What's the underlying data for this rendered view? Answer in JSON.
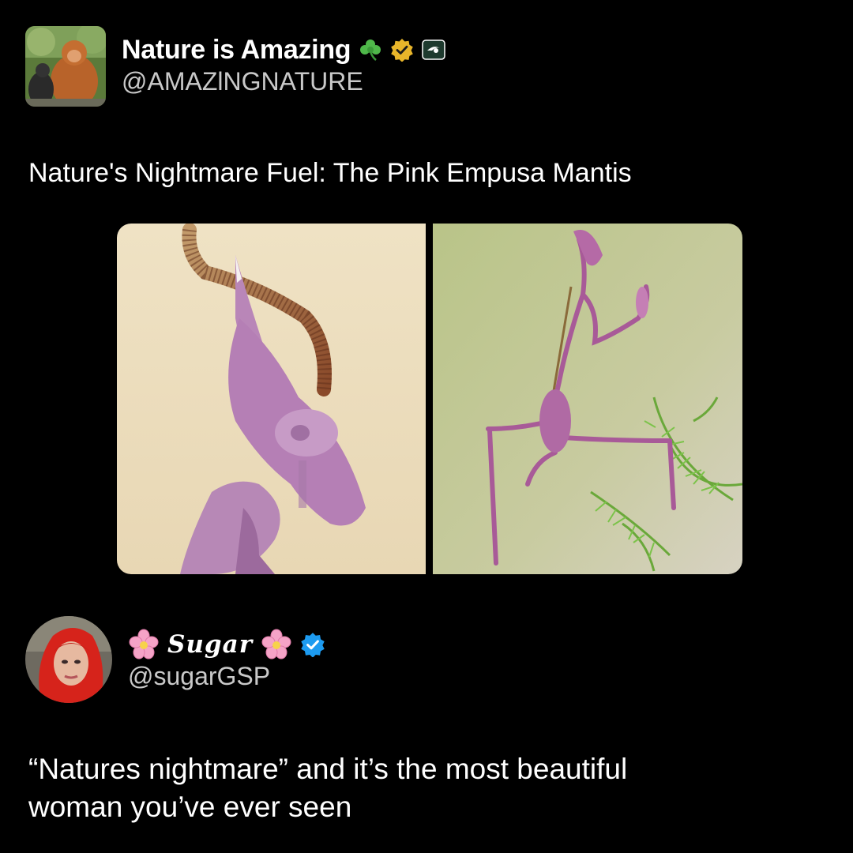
{
  "posts": [
    {
      "author": {
        "display_name": "Nature is Amazing",
        "handle": "@AMAZlNGNATURE",
        "name_icons": [
          "shamrock-icon",
          "gold-verified-badge-icon",
          "affiliate-badge-icon"
        ],
        "avatar": "orangutan-avatar"
      },
      "text": "Nature's Nightmare Fuel: The Pink Empusa  Mantis",
      "media": [
        {
          "name": "pink-empusa-mantis-closeup-photo"
        },
        {
          "name": "pink-empusa-mantis-on-plant-photo"
        }
      ]
    },
    {
      "author": {
        "display_name": "Sugar",
        "handle": "@sugarGSP",
        "name_icons": [
          "cherry-blossom-icon",
          "cherry-blossom-icon",
          "blue-verified-badge-icon"
        ],
        "avatar": "red-haired-woman-avatar"
      },
      "text_line1": "“Natures nightmare” and it’s the most beautiful",
      "text_line2": "woman you’ve ever seen"
    }
  ],
  "colors": {
    "background": "#000000",
    "text": "#ffffff",
    "handle": "#c9c9c9",
    "gold_badge": "#e8b52a",
    "blue_badge": "#1d9bf0",
    "shamrock": "#4fb84a",
    "blossom": "#f5a3c7"
  }
}
